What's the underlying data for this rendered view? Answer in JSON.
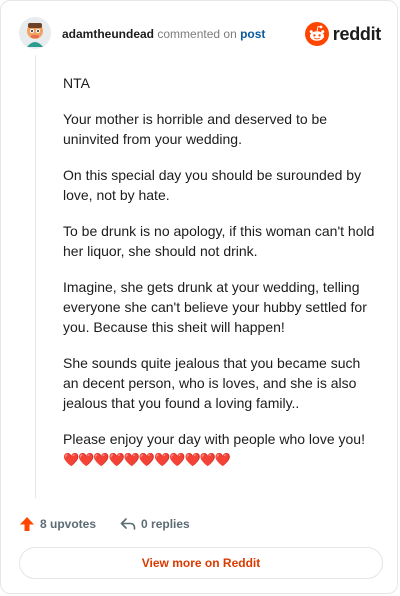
{
  "header": {
    "username": "adamtheundead",
    "verb": "commented on",
    "post_link": "post",
    "brand": "reddit"
  },
  "comment": {
    "paragraphs": [
      "NTA",
      "Your mother is horrible and deserved to be uninvited from your wedding.",
      "On this special day you should be surounded by love, not by hate.",
      "To be drunk is no apology, if this woman can't hold her liquor, she should not drink.",
      "Imagine, she gets drunk at your wedding, telling everyone she can't believe your hubby settled for you. Because this sheit will happen!",
      "She sounds quite jealous that you became such an decent person, who is loves, and she is also jealous that you found a loving family..",
      "Please enjoy your day with people who love you!"
    ],
    "hearts": "❤️❤️❤️❤️❤️❤️❤️❤️❤️❤️❤️"
  },
  "actions": {
    "upvotes": "8 upvotes",
    "replies": "0 replies"
  },
  "footer": {
    "view_more": "View more on Reddit"
  },
  "colors": {
    "reddit_orange": "#ff4500",
    "link_blue": "#0a5a9c",
    "view_more_text": "#d93a00"
  }
}
